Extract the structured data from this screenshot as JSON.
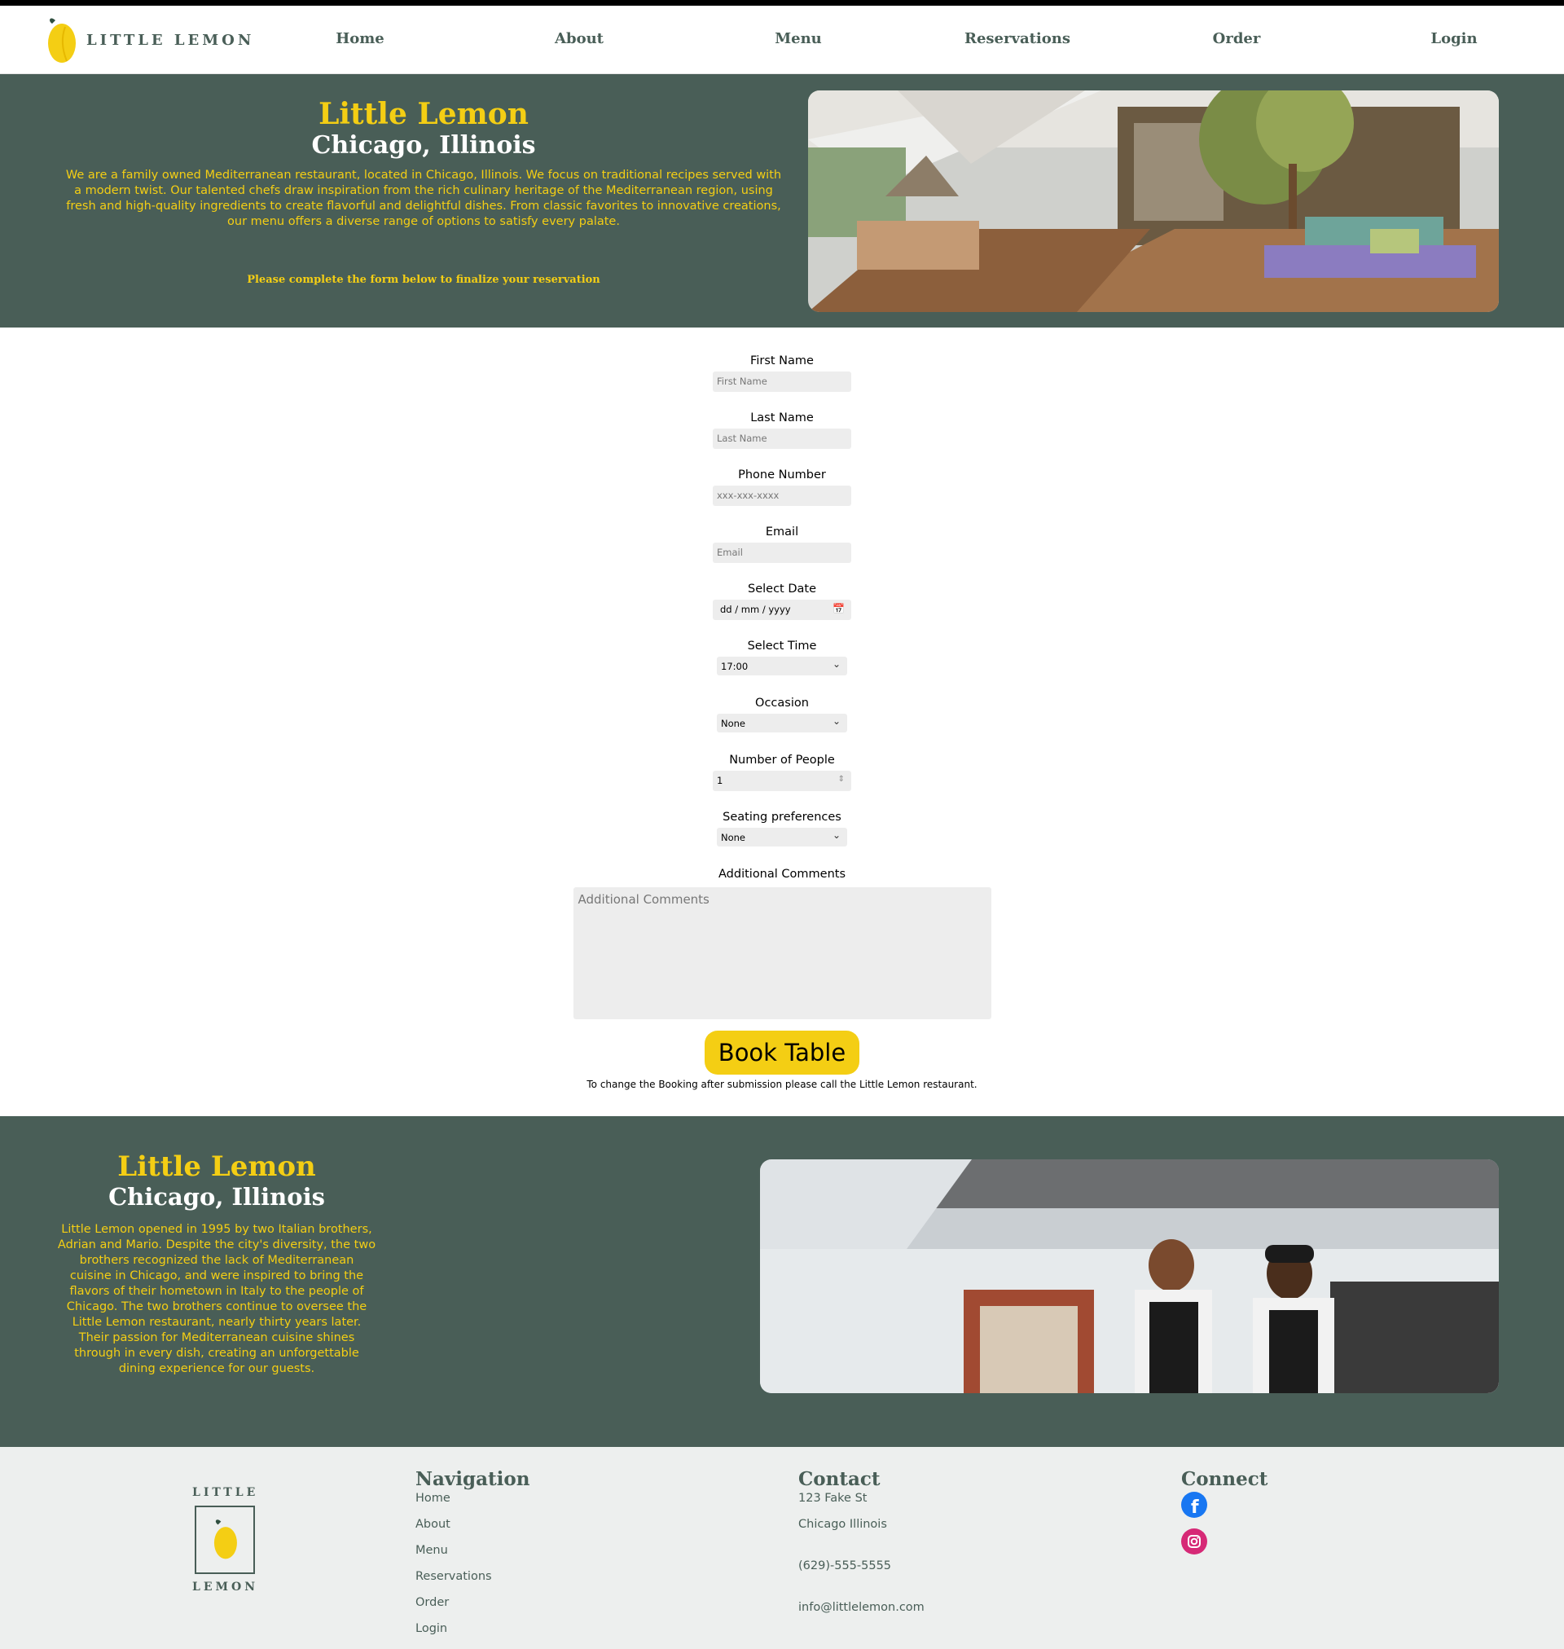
{
  "brand": {
    "logo_text": "LITTLE LEMON",
    "primary_color": "#495e57",
    "accent_color": "#f4ce14"
  },
  "nav": {
    "items": [
      "Home",
      "About",
      "Menu",
      "Reservations",
      "Order",
      "Login"
    ]
  },
  "hero": {
    "title": "Little Lemon",
    "subtitle": "Chicago, Illinois",
    "description": "We are a family owned Mediterranean restaurant, located in Chicago, Illinois. We focus on traditional recipes served with a modern twist. Our talented chefs draw inspiration from the rich culinary heritage of the Mediterranean region, using fresh and high-quality ingredients to create flavorful and delightful dishes. From classic favorites to innovative creations, our menu offers a diverse range of options to satisfy every palate.",
    "note": "Please complete the form below to finalize your reservation"
  },
  "form": {
    "first_name": {
      "label": "First Name",
      "placeholder": "First Name"
    },
    "last_name": {
      "label": "Last Name",
      "placeholder": "Last Name"
    },
    "phone": {
      "label": "Phone Number",
      "placeholder": "xxx-xxx-xxxx"
    },
    "email": {
      "label": "Email",
      "placeholder": "Email"
    },
    "date": {
      "label": "Select Date",
      "value": "dd / mm / yyyy"
    },
    "time": {
      "label": "Select Time",
      "value": "17:00"
    },
    "occasion": {
      "label": "Occasion",
      "value": "None"
    },
    "people": {
      "label": "Number of People",
      "value": "1"
    },
    "seating": {
      "label": "Seating preferences",
      "value": "None"
    },
    "comments": {
      "label": "Additional Comments",
      "placeholder": "Additional Comments"
    },
    "submit_label": "Book Table",
    "change_note": "To change the Booking after submission please call the Little Lemon restaurant."
  },
  "about": {
    "title": "Little Lemon",
    "subtitle": "Chicago, Illinois",
    "description": "Little Lemon opened in 1995 by two Italian brothers, Adrian and Mario. Despite the city's diversity, the two brothers recognized the lack of Mediterranean cuisine in Chicago, and were inspired to bring the flavors of their hometown in Italy to the people of Chicago. The two brothers continue to oversee the Little Lemon restaurant, nearly thirty years later. Their passion for Mediterranean cuisine shines through in every dish, creating an unforgettable dining experience for our guests."
  },
  "footer": {
    "logo_top": "LITTLE",
    "logo_bottom": "LEMON",
    "navigation": {
      "title": "Navigation",
      "items": [
        "Home",
        "About",
        "Menu",
        "Reservations",
        "Order",
        "Login"
      ]
    },
    "contact": {
      "title": "Contact",
      "address1": "123 Fake St",
      "address2": "Chicago Illinois",
      "phone": "(629)-555-5555",
      "email": "info@littlelemon.com"
    },
    "connect": {
      "title": "Connect",
      "icons": [
        "facebook-icon",
        "instagram-icon"
      ]
    }
  }
}
